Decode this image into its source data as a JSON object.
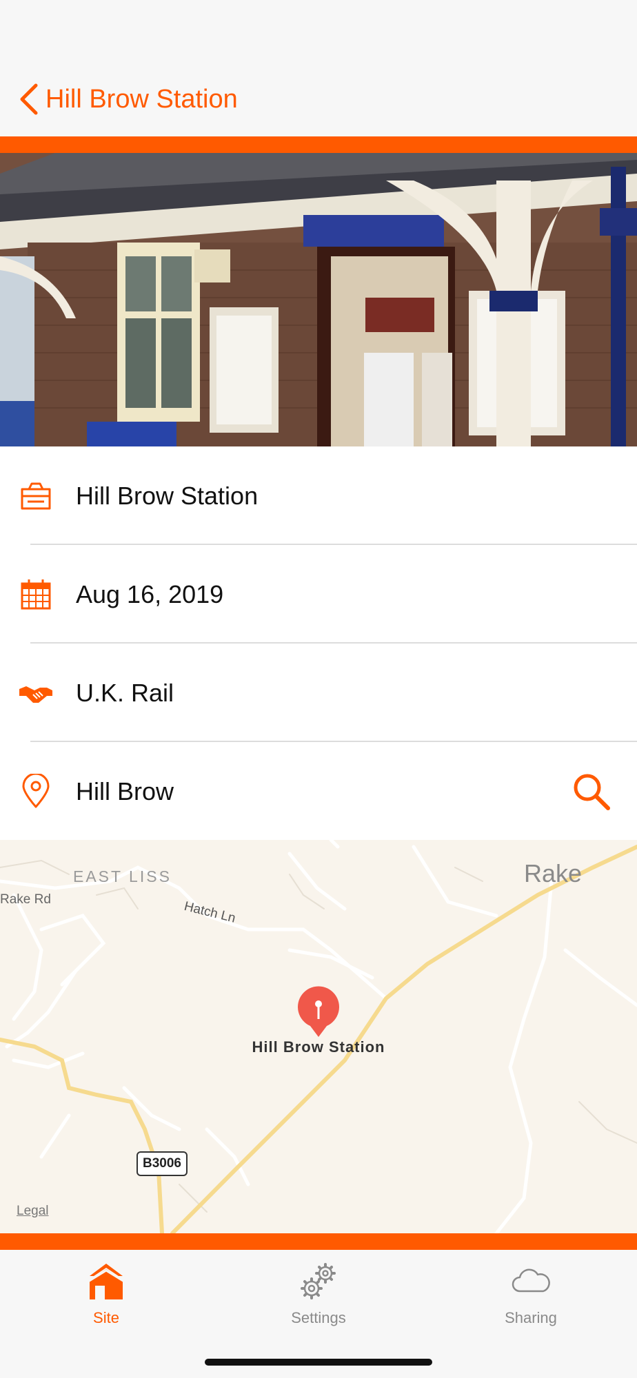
{
  "nav": {
    "back_title": "Hill Brow Station"
  },
  "colors": {
    "accent": "#ff5a00",
    "map_bg": "#f9f4ec",
    "pin": "#f0584a"
  },
  "details": {
    "site_name": "Hill Brow Station",
    "date": "Aug 16, 2019",
    "organization": "U.K. Rail",
    "location": "Hill Brow"
  },
  "map": {
    "labels": {
      "east_liss": "EAST LISS",
      "rake": "Rake",
      "rake_rd": "Rake Rd",
      "hatch_ln": "Hatch Ln",
      "road_badge": "B3006"
    },
    "pin_label": "Hill Brow Station",
    "legal": "Legal"
  },
  "tabs": [
    {
      "label": "Site",
      "icon": "house-icon",
      "active": true
    },
    {
      "label": "Settings",
      "icon": "gears-icon",
      "active": false
    },
    {
      "label": "Sharing",
      "icon": "cloud-icon",
      "active": false
    }
  ]
}
